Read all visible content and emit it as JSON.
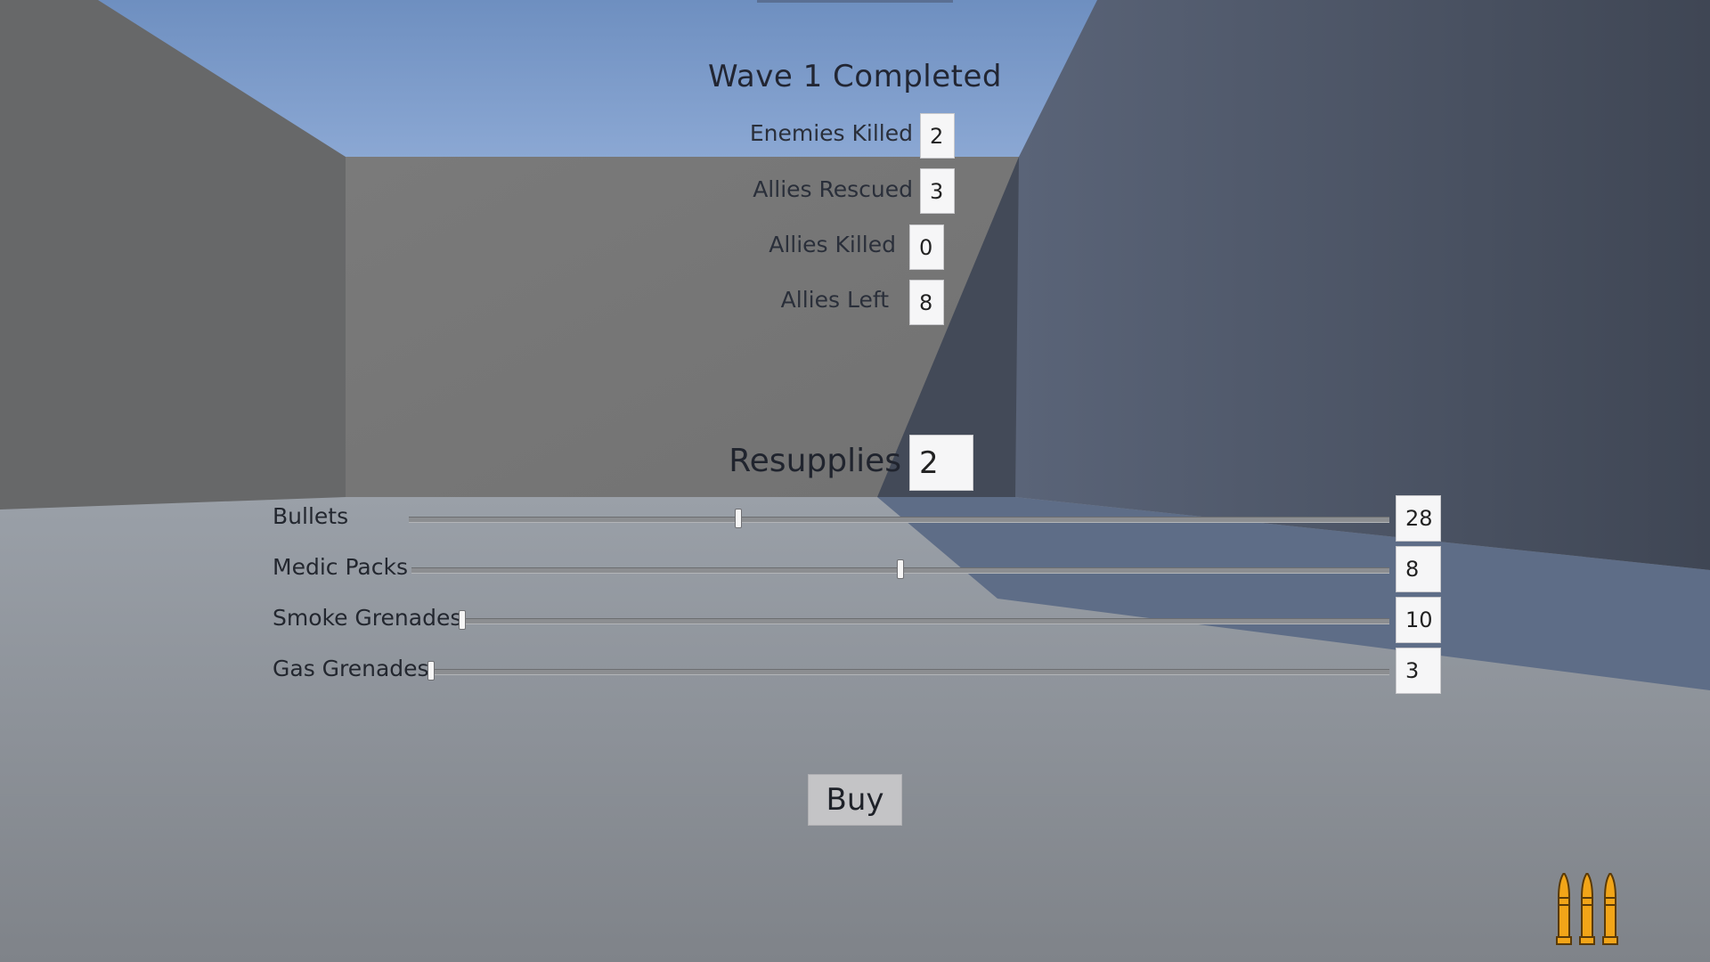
{
  "summary": {
    "title": "Wave 1 Completed",
    "stats": [
      {
        "label": "Enemies Killed",
        "value": "2"
      },
      {
        "label": "Allies Rescued",
        "value": "3"
      },
      {
        "label": "Allies Killed",
        "value": "0"
      },
      {
        "label": "Allies Left",
        "value": "8"
      }
    ]
  },
  "resupplies": {
    "label": "Resupplies",
    "value": "2"
  },
  "supplies": [
    {
      "label": "Bullets",
      "value": "28",
      "slider_fraction": 0.335
    },
    {
      "label": "Medic Packs",
      "value": "8",
      "slider_fraction": 0.5
    },
    {
      "label": "Smoke Grenades",
      "value": "10",
      "slider_fraction": 0.0
    },
    {
      "label": "Gas Grenades",
      "value": "3",
      "slider_fraction": 0.0
    }
  ],
  "buy_button": {
    "label": "Buy"
  },
  "hud": {
    "ammo_icon": "bullets-icon"
  },
  "colors": {
    "ammo": "#f2a518",
    "sky": "#7f9fce"
  }
}
